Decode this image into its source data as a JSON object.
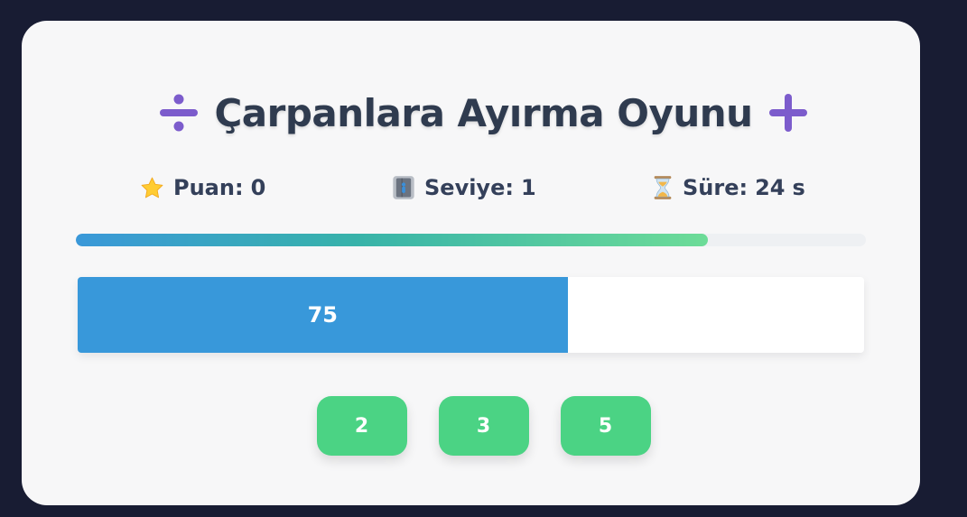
{
  "game": {
    "title": "Çarpanlara Ayırma Oyunu",
    "title_left_icon": "divide-icon",
    "title_right_icon": "plus-icon",
    "accent_color": "#7c5ccc"
  },
  "stats": {
    "score": {
      "icon": "star-icon",
      "label": "Puan:",
      "value": "0"
    },
    "level": {
      "icon": "elevator-icon",
      "label": "Seviye:",
      "value": "1"
    },
    "time": {
      "icon": "hourglass-icon",
      "label": "Süre:",
      "value": "24",
      "unit": "s"
    }
  },
  "progress": {
    "fraction": 0.8
  },
  "number": {
    "value": "75",
    "remaining_fraction": 0.623,
    "fill_color": "#3898da"
  },
  "options": [
    "2",
    "3",
    "5"
  ],
  "colors": {
    "background": "#181c33",
    "card": "#f7f7f8",
    "option_button": "#4bd384",
    "text": "#2f3b4f"
  }
}
